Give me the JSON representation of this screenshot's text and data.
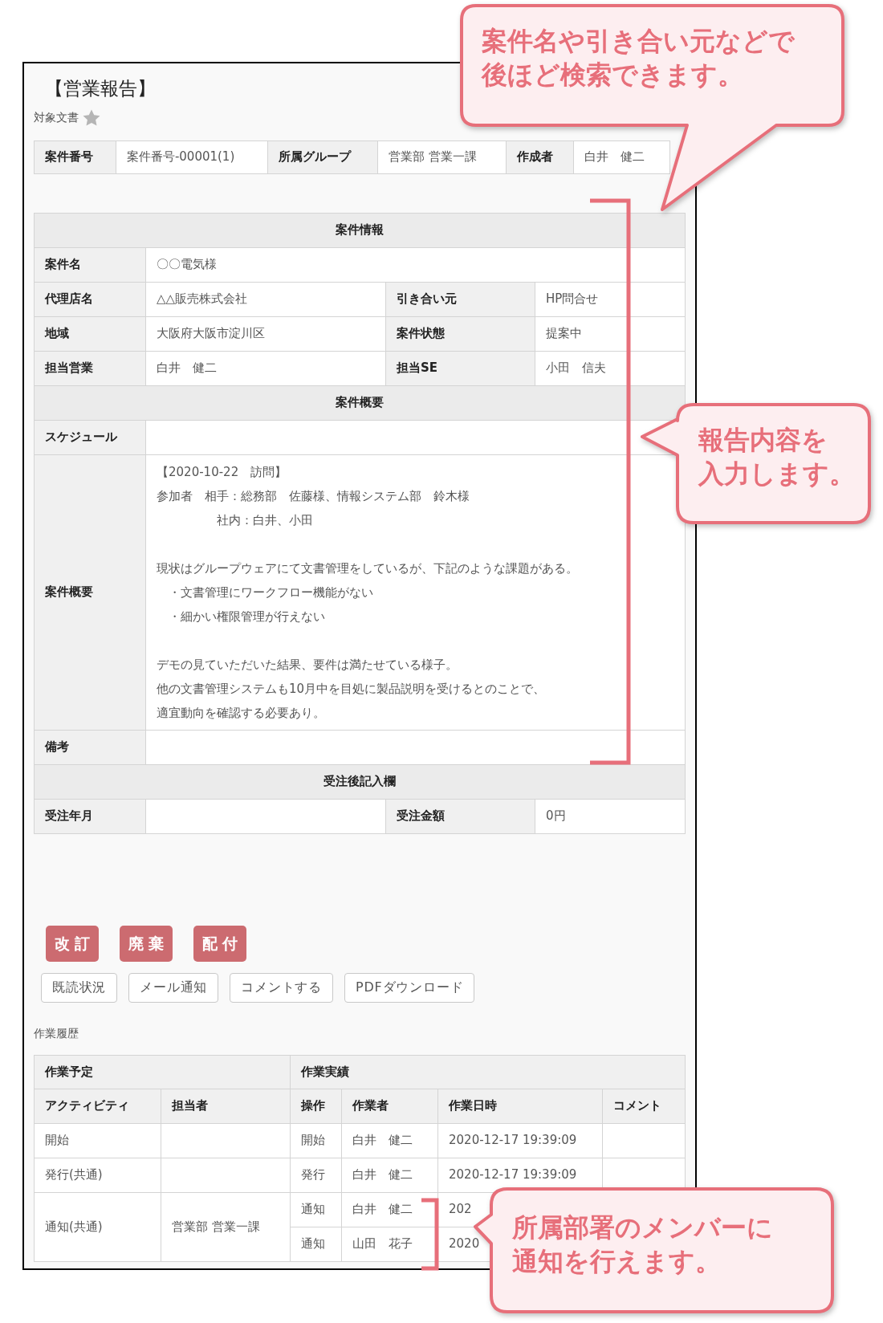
{
  "document": {
    "title": "【営業報告】",
    "subtitle": "対象文書",
    "favorite": false
  },
  "header_fields": [
    {
      "label": "案件番号",
      "value": "案件番号-00001(1)"
    },
    {
      "label": "所属グループ",
      "value": "営業部 営業一課"
    },
    {
      "label": "作成者",
      "value": "白井　健二"
    }
  ],
  "sections": [
    {
      "title": "案件情報",
      "rows": [
        [
          {
            "label": "案件名",
            "value": "〇〇電気様"
          }
        ],
        [
          {
            "label": "代理店名",
            "value": "△△販売株式会社"
          },
          {
            "label": "引き合い元",
            "value": "HP問合せ"
          }
        ],
        [
          {
            "label": "地域",
            "value": "大阪府大阪市淀川区"
          },
          {
            "label": "案件状態",
            "value": "提案中"
          }
        ],
        [
          {
            "label": "担当営業",
            "value": "白井　健二"
          },
          {
            "label": "担当SE",
            "value": "小田　信夫"
          }
        ]
      ]
    },
    {
      "title": "案件概要",
      "rows": [
        [
          {
            "label": "スケジュール"
          }
        ],
        [
          {
            "label": "案件概要",
            "paragraphs": [
              [
                "【2020-10-22　訪問】",
                "参加者　相手：総務部　佐藤様、情報システム部　鈴木様",
                "　　　　　社内：白井、小田"
              ],
              [
                "現状はグループウェアにて文書管理をしているが、下記のような課題がある。",
                "　・文書管理にワークフロー機能がない",
                "　・細かい権限管理が行えない"
              ],
              [
                "デモの見ていただいた結果、要件は満たせている様子。",
                "他の文書管理システムも10月中を目処に製品説明を受けるとのことで、",
                "適宜動向を確認する必要あり。"
              ]
            ]
          }
        ],
        [
          {
            "label": "備考"
          }
        ]
      ]
    },
    {
      "title": "受注後記入欄",
      "rows": [
        [
          {
            "label": "受注年月"
          },
          {
            "label": "受注金額",
            "value": "0円"
          }
        ]
      ]
    }
  ],
  "actions": [
    "改訂",
    "廃棄",
    "配付"
  ],
  "secondary_actions": [
    "既読状況",
    "メール通知",
    "コメントする",
    "PDFダウンロード"
  ],
  "history": {
    "title": "作業履歴",
    "group_headers": [
      "作業予定",
      "作業実績"
    ],
    "columns": [
      "アクティビティ",
      "担当者",
      "操作",
      "作業者",
      "作業日時",
      "コメント"
    ],
    "rows": [
      {
        "activity": "開始",
        "results": [
          {
            "operation": "開始",
            "worker": "白井　健二",
            "datetime": "2020-12-17 19:39:09"
          }
        ]
      },
      {
        "activity": "発行(共通)",
        "results": [
          {
            "operation": "発行",
            "worker": "白井　健二",
            "datetime": "2020-12-17 19:39:09"
          }
        ]
      },
      {
        "activity": "通知(共通)",
        "assignee": "営業部 営業一課",
        "results": [
          {
            "operation": "通知",
            "worker": "白井　健二",
            "datetime": "202"
          },
          {
            "operation": "通知",
            "worker": "山田　花子",
            "datetime": "2020"
          }
        ]
      }
    ]
  },
  "callouts": [
    {
      "lines": [
        "案件名や引き合い元などで",
        "後ほど検索できます。"
      ]
    },
    {
      "lines": [
        "報告内容を",
        "入力します。"
      ]
    },
    {
      "lines": [
        "所属部署のメンバーに",
        "通知を行えます。"
      ]
    }
  ]
}
